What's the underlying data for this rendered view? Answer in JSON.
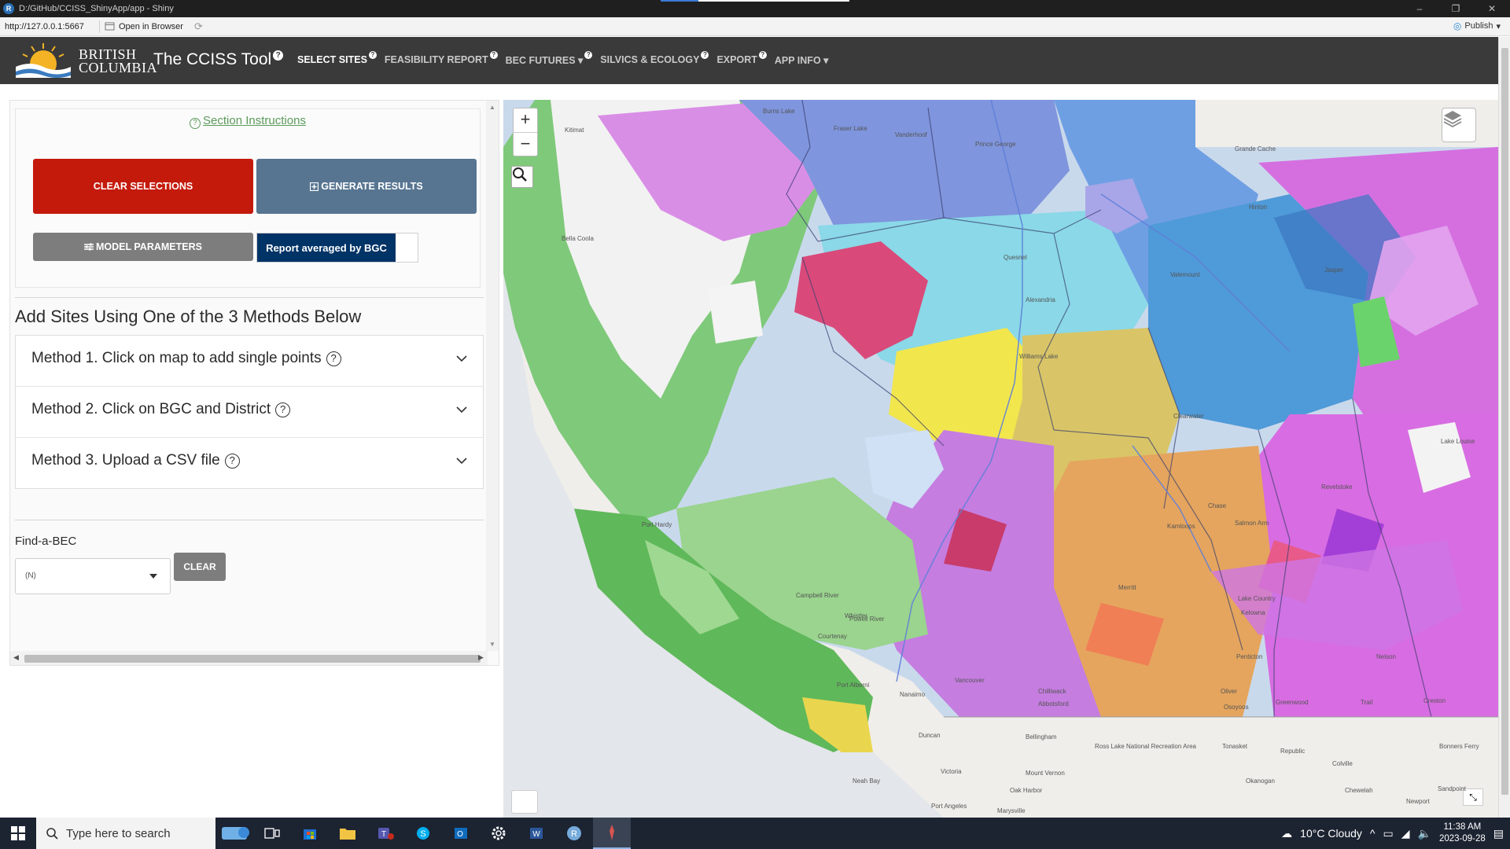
{
  "window": {
    "title": "D:/GitHub/CCISS_ShinyApp/app - Shiny",
    "controls": [
      "–",
      "❐",
      "✕"
    ]
  },
  "viewer": {
    "url": "http://127.0.0.1:5667",
    "open_in_browser": "Open in Browser",
    "publish": "Publish"
  },
  "appnav": {
    "logo_line1": "BRITISH",
    "logo_line2": "COLUMBIA",
    "title": "The CCISS Tool",
    "items": [
      {
        "label": "SELECT SITES",
        "active": true
      },
      {
        "label": "FEASIBILITY REPORT",
        "active": false
      },
      {
        "label": "BEC FUTURES ▾",
        "active": false
      },
      {
        "label": "SILVICS & ECOLOGY",
        "active": false
      },
      {
        "label": "EXPORT",
        "active": false
      },
      {
        "label": "APP INFO ▾",
        "active": false
      }
    ]
  },
  "panel": {
    "section_instructions": "Section Instructions",
    "clear_selections": "CLEAR SELECTIONS",
    "generate_results": "GENERATE RESULTS",
    "model_parameters": "MODEL PARAMETERS",
    "report_toggle": "Report averaged by BGC",
    "add_sites_heading": "Add Sites Using One of the 3 Methods Below",
    "methods": [
      "Method 1. Click on map to add single points",
      "Method 2. Click on BGC and District",
      "Method 3. Upload a CSV file"
    ],
    "find_a_bec_label": "Find-a-BEC",
    "find_a_bec_value": "(N)",
    "clear_bec": "CLEAR"
  },
  "map": {
    "zoom_in": "+",
    "zoom_out": "−",
    "place_labels": [
      "Burns Lake",
      "Fraser Lake",
      "Vanderhoof",
      "Prince George",
      "Grande Cache",
      "Hinton",
      "Quesnel",
      "Valemount",
      "Jasper",
      "Williams Lake",
      "Clearwater",
      "Revelstoke",
      "Kamloops",
      "Salmon Arm",
      "Chase",
      "Lake Country",
      "Kelowna",
      "Merritt",
      "Whistler",
      "Campbell River",
      "Courtenay",
      "Powell River",
      "Port Alberni",
      "Nanaimo",
      "Duncan",
      "Victoria",
      "Vancouver",
      "Chilliwack",
      "Abbotsford",
      "Bellingham",
      "Mount Vernon",
      "Oak Harbor",
      "Port Angeles",
      "Neah Bay",
      "Tonasket",
      "Republic",
      "Colville",
      "Chewelah",
      "Sandpoint",
      "Bonners Ferry",
      "Nelson",
      "Trail",
      "Creston",
      "Penticton",
      "Oliver",
      "Osoyoos",
      "Greenwood",
      "Port Hardy",
      "Bella Coola",
      "Okanogan",
      "Newport",
      "Lake Louise",
      "Kitimat",
      "Alexandria",
      "Marysville",
      "Ross Lake National Recreation Area"
    ]
  },
  "taskbar": {
    "search_placeholder": "Type here to search",
    "weather": "10°C  Cloudy",
    "time": "11:38 AM",
    "date": "2023-09-28"
  }
}
